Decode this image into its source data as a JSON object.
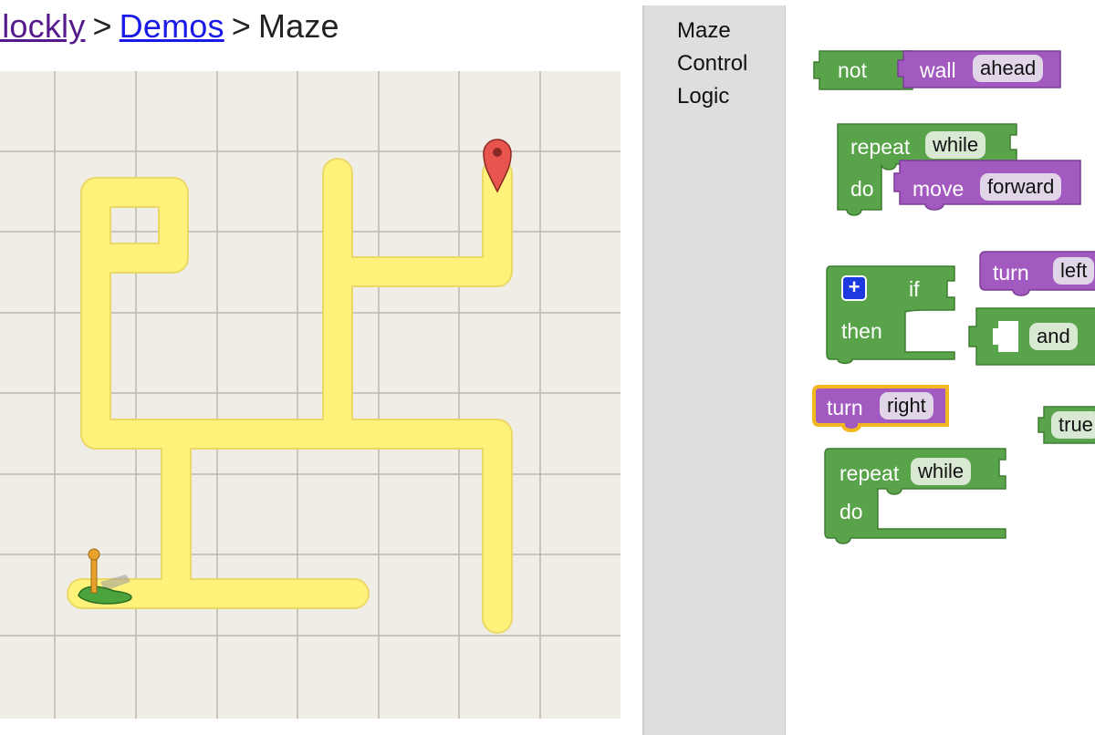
{
  "breadcrumb": {
    "items": [
      {
        "label": "Blockly",
        "link": true
      },
      {
        "label": "Demos",
        "link": true
      },
      {
        "label": "Maze",
        "link": false
      }
    ],
    "separator": ">"
  },
  "toolbox": {
    "categories": [
      "Maze",
      "Control",
      "Logic"
    ]
  },
  "blocks": {
    "not_wall": {
      "not": "not",
      "wall": "wall",
      "ahead": "ahead"
    },
    "repeat_move": {
      "repeat": "repeat",
      "while": "while",
      "do": "do",
      "move": "move",
      "forward": "forward"
    },
    "turn_left": {
      "turn": "turn",
      "dir": "left"
    },
    "if_then": {
      "plus": "+",
      "if": "if",
      "then": "then"
    },
    "and": {
      "label": "and"
    },
    "turn_right": {
      "turn": "turn",
      "dir": "right"
    },
    "true": {
      "label": "true"
    },
    "repeat_empty": {
      "repeat": "repeat",
      "while": "while",
      "do": "do"
    }
  },
  "colors": {
    "logic_green": "#59a44a",
    "action_purple": "#a35ac0",
    "path_yellow": "#fff27a",
    "selected_outline": "#f2b81f"
  }
}
